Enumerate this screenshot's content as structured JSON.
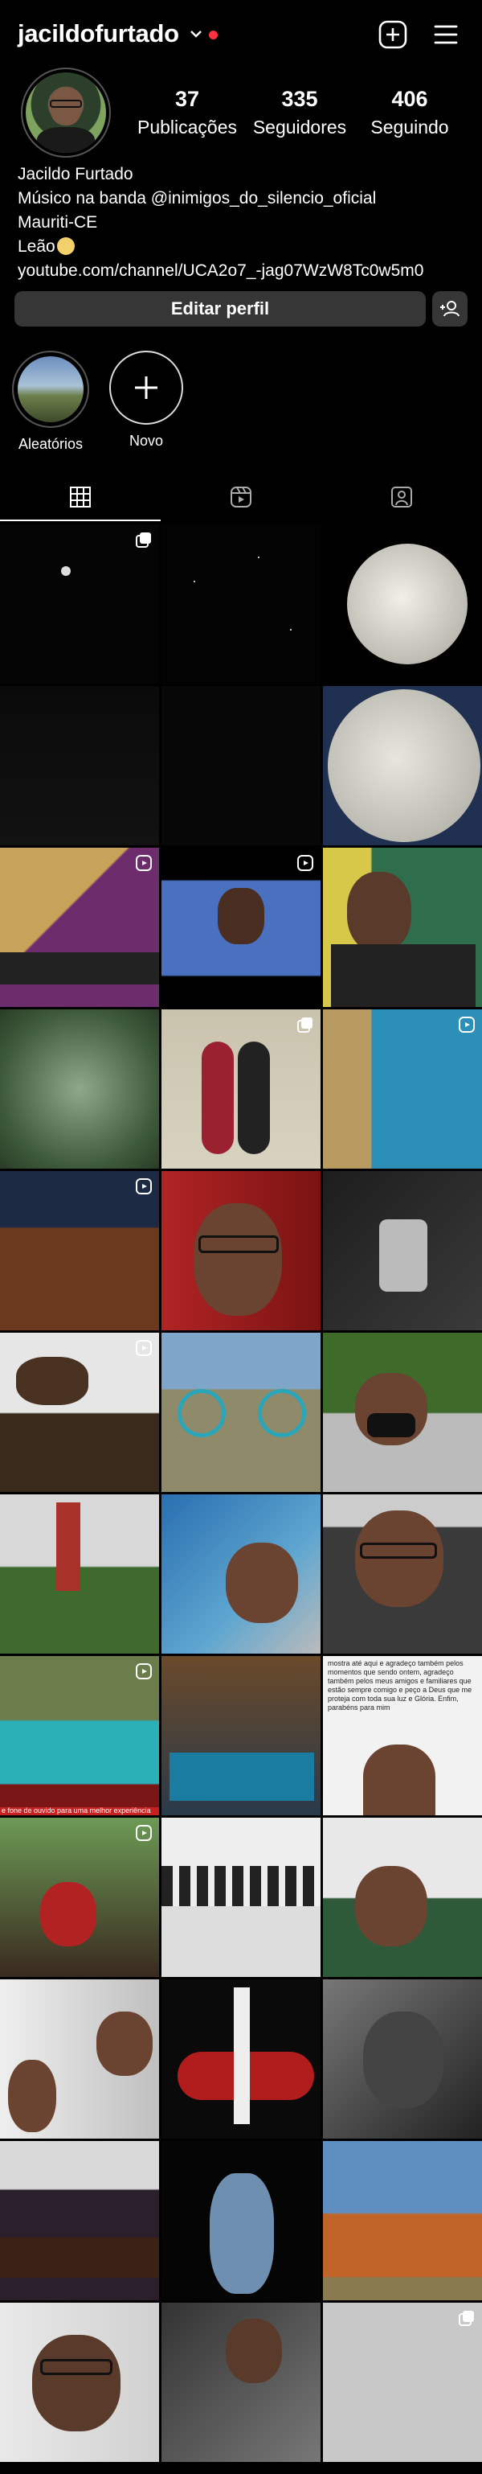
{
  "header": {
    "username": "jacildofurtado"
  },
  "profile": {
    "stats": [
      {
        "value": "37",
        "label": "Publicações"
      },
      {
        "value": "335",
        "label": "Seguidores"
      },
      {
        "value": "406",
        "label": "Seguindo"
      }
    ],
    "bio": {
      "name": "Jacildo Furtado",
      "line1": "Músico na banda @inimigos_do_silencio_oficial",
      "line2": "Mauriti-CE",
      "line3": "Leão",
      "link": "youtube.com/channel/UCA2o7_-jag07WzW8Tc0w5m0"
    },
    "edit_button": "Editar perfil"
  },
  "highlights": [
    {
      "label": "Aleatórios"
    },
    {
      "label": "Novo"
    }
  ],
  "tabs": [
    {
      "icon": "grid-icon"
    },
    {
      "icon": "reels-icon"
    },
    {
      "icon": "tagged-icon"
    }
  ],
  "posts": {
    "count_visible": 36,
    "caption_snippet_row11": "mostra até aqui e agradeço também pelos momentos que sendo ontem, agradeço também pelos meus amigos e familiares que estão sempre comigo e peço a Deus que me proteja com toda sua luz e Glória. Enfim, parabéns para mim",
    "caption_snippet_row11_b": "e fone de ouvido para uma melhor experiência"
  },
  "colors": {
    "background": "#000000",
    "button": "#363636",
    "notification": "#ff3040",
    "active_tab": "#ffffff"
  }
}
